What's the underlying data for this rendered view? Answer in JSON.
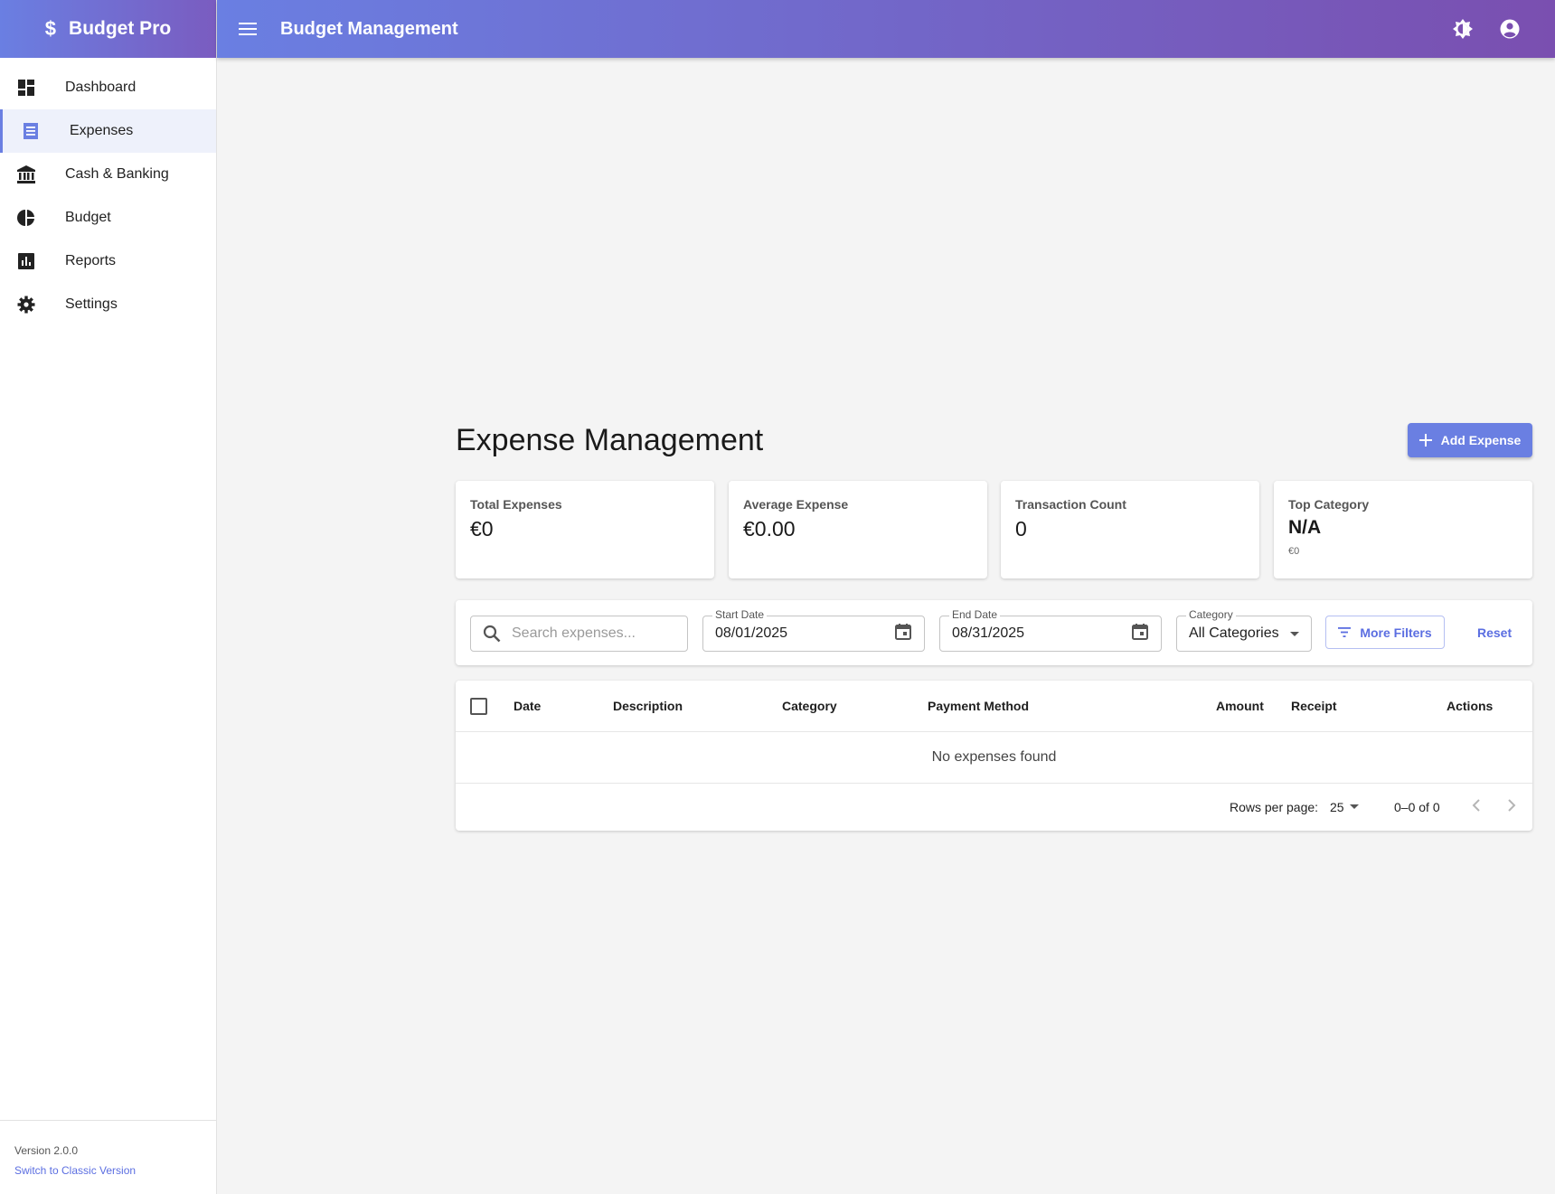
{
  "sidebar": {
    "brand_icon": "$",
    "brand_name": "Budget Pro",
    "items": [
      {
        "label": "Dashboard",
        "icon": "dashboard-icon"
      },
      {
        "label": "Expenses",
        "icon": "receipt-icon",
        "active": true
      },
      {
        "label": "Cash & Banking",
        "icon": "bank-icon"
      },
      {
        "label": "Budget",
        "icon": "pie-chart-icon"
      },
      {
        "label": "Reports",
        "icon": "bar-chart-icon"
      },
      {
        "label": "Settings",
        "icon": "gear-icon"
      }
    ],
    "version": "Version 2.0.0",
    "classic_link": "Switch to Classic Version"
  },
  "header": {
    "title": "Budget Management",
    "icons": [
      "menu-icon",
      "theme-toggle-icon",
      "account-icon"
    ]
  },
  "page": {
    "title": "Expense Management",
    "add_button": "Add Expense"
  },
  "stats": [
    {
      "label": "Total Expenses",
      "value": "€0"
    },
    {
      "label": "Average Expense",
      "value": "€0.00"
    },
    {
      "label": "Transaction Count",
      "value": "0"
    },
    {
      "label": "Top Category",
      "value": "N/A",
      "sub": "€0"
    }
  ],
  "filters": {
    "search_placeholder": "Search expenses...",
    "start_date_label": "Start Date",
    "start_date": "08/01/2025",
    "end_date_label": "End Date",
    "end_date": "08/31/2025",
    "category_label": "Category",
    "category_value": "All Categories",
    "more_filters": "More Filters",
    "reset": "Reset"
  },
  "table": {
    "columns": [
      "Date",
      "Description",
      "Category",
      "Payment Method",
      "Amount",
      "Receipt",
      "Actions"
    ],
    "empty_text": "No expenses found",
    "rows_per_page_label": "Rows per page:",
    "rows_per_page": "25",
    "range": "0–0 of 0"
  },
  "colors": {
    "accent": "#6a7fe2",
    "header_gradient_end": "#7a4fb0",
    "link": "#5b6ee1",
    "background": "#f4f4f4"
  }
}
